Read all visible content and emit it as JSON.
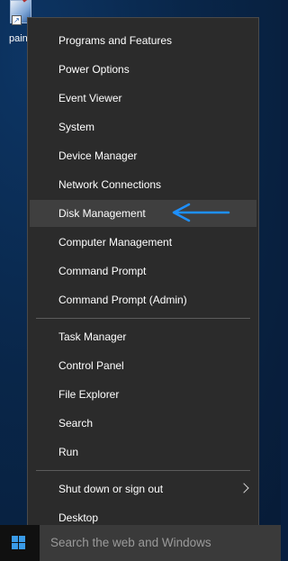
{
  "desktop": {
    "icon_label": "paint"
  },
  "menu": {
    "groups": [
      [
        {
          "label": "Programs and Features"
        },
        {
          "label": "Power Options"
        },
        {
          "label": "Event Viewer"
        },
        {
          "label": "System"
        },
        {
          "label": "Device Manager"
        },
        {
          "label": "Network Connections"
        },
        {
          "label": "Disk Management",
          "highlighted": true
        },
        {
          "label": "Computer Management"
        },
        {
          "label": "Command Prompt"
        },
        {
          "label": "Command Prompt (Admin)"
        }
      ],
      [
        {
          "label": "Task Manager"
        },
        {
          "label": "Control Panel"
        },
        {
          "label": "File Explorer"
        },
        {
          "label": "Search"
        },
        {
          "label": "Run"
        }
      ],
      [
        {
          "label": "Shut down or sign out",
          "submenu": true
        },
        {
          "label": "Desktop"
        }
      ]
    ]
  },
  "annotation": {
    "arrow_color": "#1e90ff",
    "points_to": "Disk Management"
  },
  "taskbar": {
    "start_icon": "windows-logo-icon",
    "search_placeholder": "Search the web and Windows"
  },
  "colors": {
    "menu_background": "#2b2b2b",
    "menu_highlight": "#3f3f3f",
    "accent": "#3a9be8"
  }
}
